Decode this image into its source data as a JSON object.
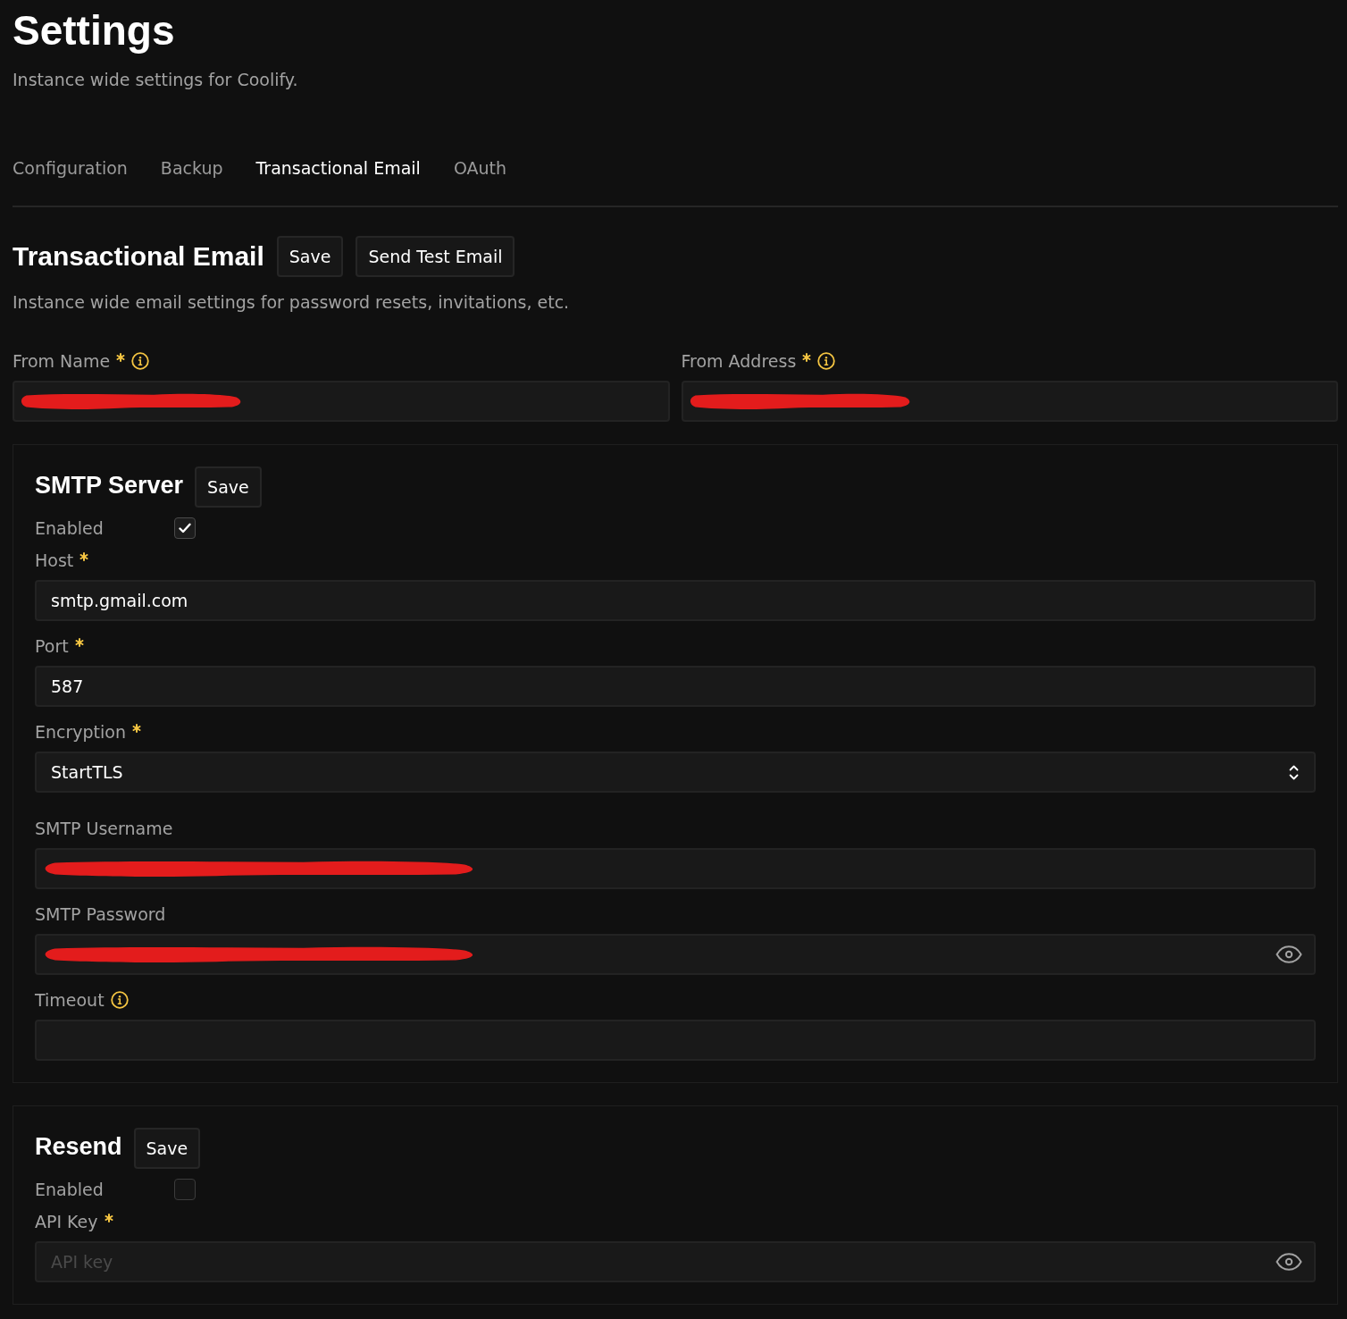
{
  "header": {
    "title": "Settings",
    "subtitle": "Instance wide settings for Coolify."
  },
  "tabs": [
    {
      "label": "Configuration",
      "selected": false
    },
    {
      "label": "Backup",
      "selected": false
    },
    {
      "label": "Transactional Email",
      "selected": true
    },
    {
      "label": "OAuth",
      "selected": false
    }
  ],
  "section": {
    "title": "Transactional Email",
    "buttons": [
      "Save",
      "Send Test Email"
    ],
    "description": "Instance wide email settings for password resets, invitations, etc.",
    "fields": [
      {
        "kind": "text",
        "label": "From Name",
        "required": true,
        "info": true,
        "redacted": true
      },
      {
        "kind": "text",
        "label": "From Address",
        "required": true,
        "info": true,
        "redacted": true
      }
    ]
  },
  "cards": [
    {
      "title": "SMTP Server",
      "button": "Save",
      "fields": [
        {
          "kind": "checkbox",
          "label": "Enabled",
          "checked": true
        },
        {
          "kind": "text",
          "label": "Host",
          "required": true,
          "value": "smtp.gmail.com"
        },
        {
          "kind": "text",
          "label": "Port",
          "required": true,
          "value": "587"
        },
        {
          "kind": "select",
          "label": "Encryption",
          "required": true,
          "value": "StartTLS"
        },
        {
          "kind": "text",
          "label": "SMTP Username",
          "redacted": true
        },
        {
          "kind": "password",
          "label": "SMTP Password",
          "redacted": true
        },
        {
          "kind": "text",
          "label": "Timeout",
          "info": true
        }
      ]
    },
    {
      "title": "Resend",
      "button": "Save",
      "fields": [
        {
          "kind": "checkbox",
          "label": "Enabled",
          "checked": false
        },
        {
          "kind": "password",
          "label": "API Key",
          "required": true,
          "placeholder": "API key"
        }
      ]
    }
  ]
}
